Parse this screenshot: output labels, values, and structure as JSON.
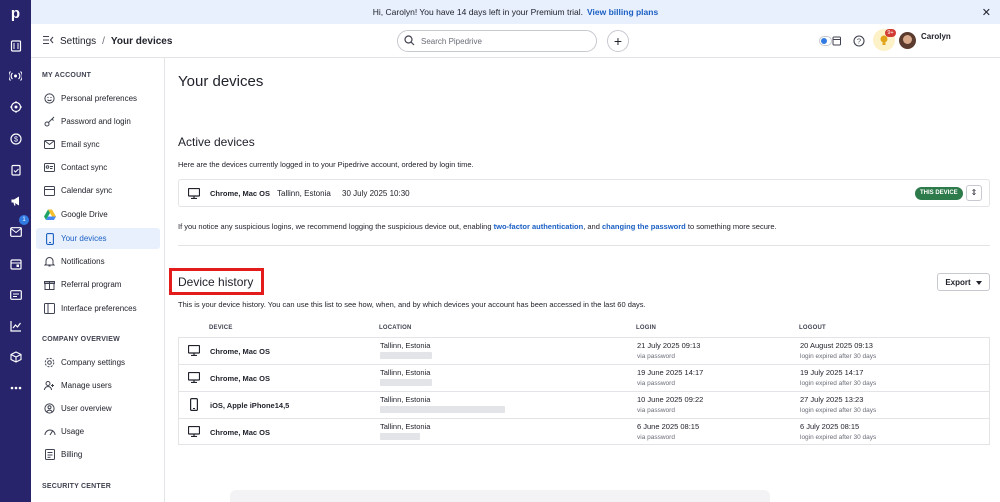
{
  "app": {
    "logo_letter": "p"
  },
  "rail": {
    "icons": [
      "deals-icon",
      "broadcast-icon",
      "leads-target-icon",
      "dollar-icon",
      "activities-icon",
      "campaigns-megaphone-icon",
      "mail-icon",
      "calendar-icon",
      "contacts-card-icon",
      "insights-chart-icon",
      "products-box-icon",
      "more-icon"
    ],
    "mail_badge": "1"
  },
  "banner": {
    "text": "Hi, Carolyn! You have 14 days left in your Premium trial.",
    "link": "View billing plans"
  },
  "topbar": {
    "breadcrumb_root": "Settings",
    "breadcrumb_sep": "/",
    "breadcrumb_current": "Your devices",
    "search_placeholder": "Search Pipedrive",
    "notif_badge": "9+",
    "user_name": "Carolyn"
  },
  "sidebar": {
    "sections": [
      {
        "title": "MY ACCOUNT"
      },
      {
        "title": "COMPANY OVERVIEW"
      },
      {
        "title": "SECURITY CENTER"
      }
    ],
    "my_account": [
      "Personal preferences",
      "Password and login",
      "Email sync",
      "Contact sync",
      "Calendar sync",
      "Google Drive",
      "Your devices",
      "Notifications",
      "Referral program",
      "Interface preferences"
    ],
    "company": [
      "Company settings",
      "Manage users",
      "User overview",
      "Usage",
      "Billing"
    ]
  },
  "main": {
    "title": "Your devices",
    "active": {
      "title": "Active devices",
      "desc": "Here are the devices currently logged in to your Pipedrive account, ordered by login time.",
      "device": "Chrome, Mac OS",
      "location": "Tallinn, Estonia",
      "time": "30 July 2025 10:30",
      "badge": "THIS DEVICE",
      "note_pre": "If you notice any suspicious logins, we recommend logging the suspicious device out, enabling",
      "note_link1": "two-factor authentication",
      "note_mid": ", and",
      "note_link2": "changing the password",
      "note_post": "to something more secure."
    },
    "history": {
      "title": "Device history",
      "export_label": "Export",
      "desc": "This is your device history. You can use this list to see how, when, and by which devices your account has been accessed in the last 60 days.",
      "columns": [
        "DEVICE",
        "LOCATION",
        "LOGIN",
        "LOGOUT"
      ],
      "rows": [
        {
          "device": "Chrome, Mac OS",
          "icon": "desktop-icon",
          "location": "Tallinn, Estonia",
          "login": "21 July 2025 09:13",
          "login_sub": "via password",
          "logout": "20 August 2025 09:13",
          "logout_sub": "login expired after 30 days"
        },
        {
          "device": "Chrome, Mac OS",
          "icon": "desktop-icon",
          "location": "Tallinn, Estonia",
          "login": "19 June 2025 14:17",
          "login_sub": "via password",
          "logout": "19 July 2025 14:17",
          "logout_sub": "login expired after 30 days"
        },
        {
          "device": "iOS, Apple iPhone14,5",
          "icon": "phone-icon",
          "location": "Tallinn, Estonia",
          "login": "10 June 2025 09:22",
          "login_sub": "via password",
          "logout": "27 July 2025 13:23",
          "logout_sub": "login expired after 30 days"
        },
        {
          "device": "Chrome, Mac OS",
          "icon": "desktop-icon",
          "location": "Tallinn, Estonia",
          "login": "6 June 2025 08:15",
          "login_sub": "via password",
          "logout": "6 July 2025 08:15",
          "logout_sub": "login expired after 30 days"
        }
      ]
    }
  }
}
